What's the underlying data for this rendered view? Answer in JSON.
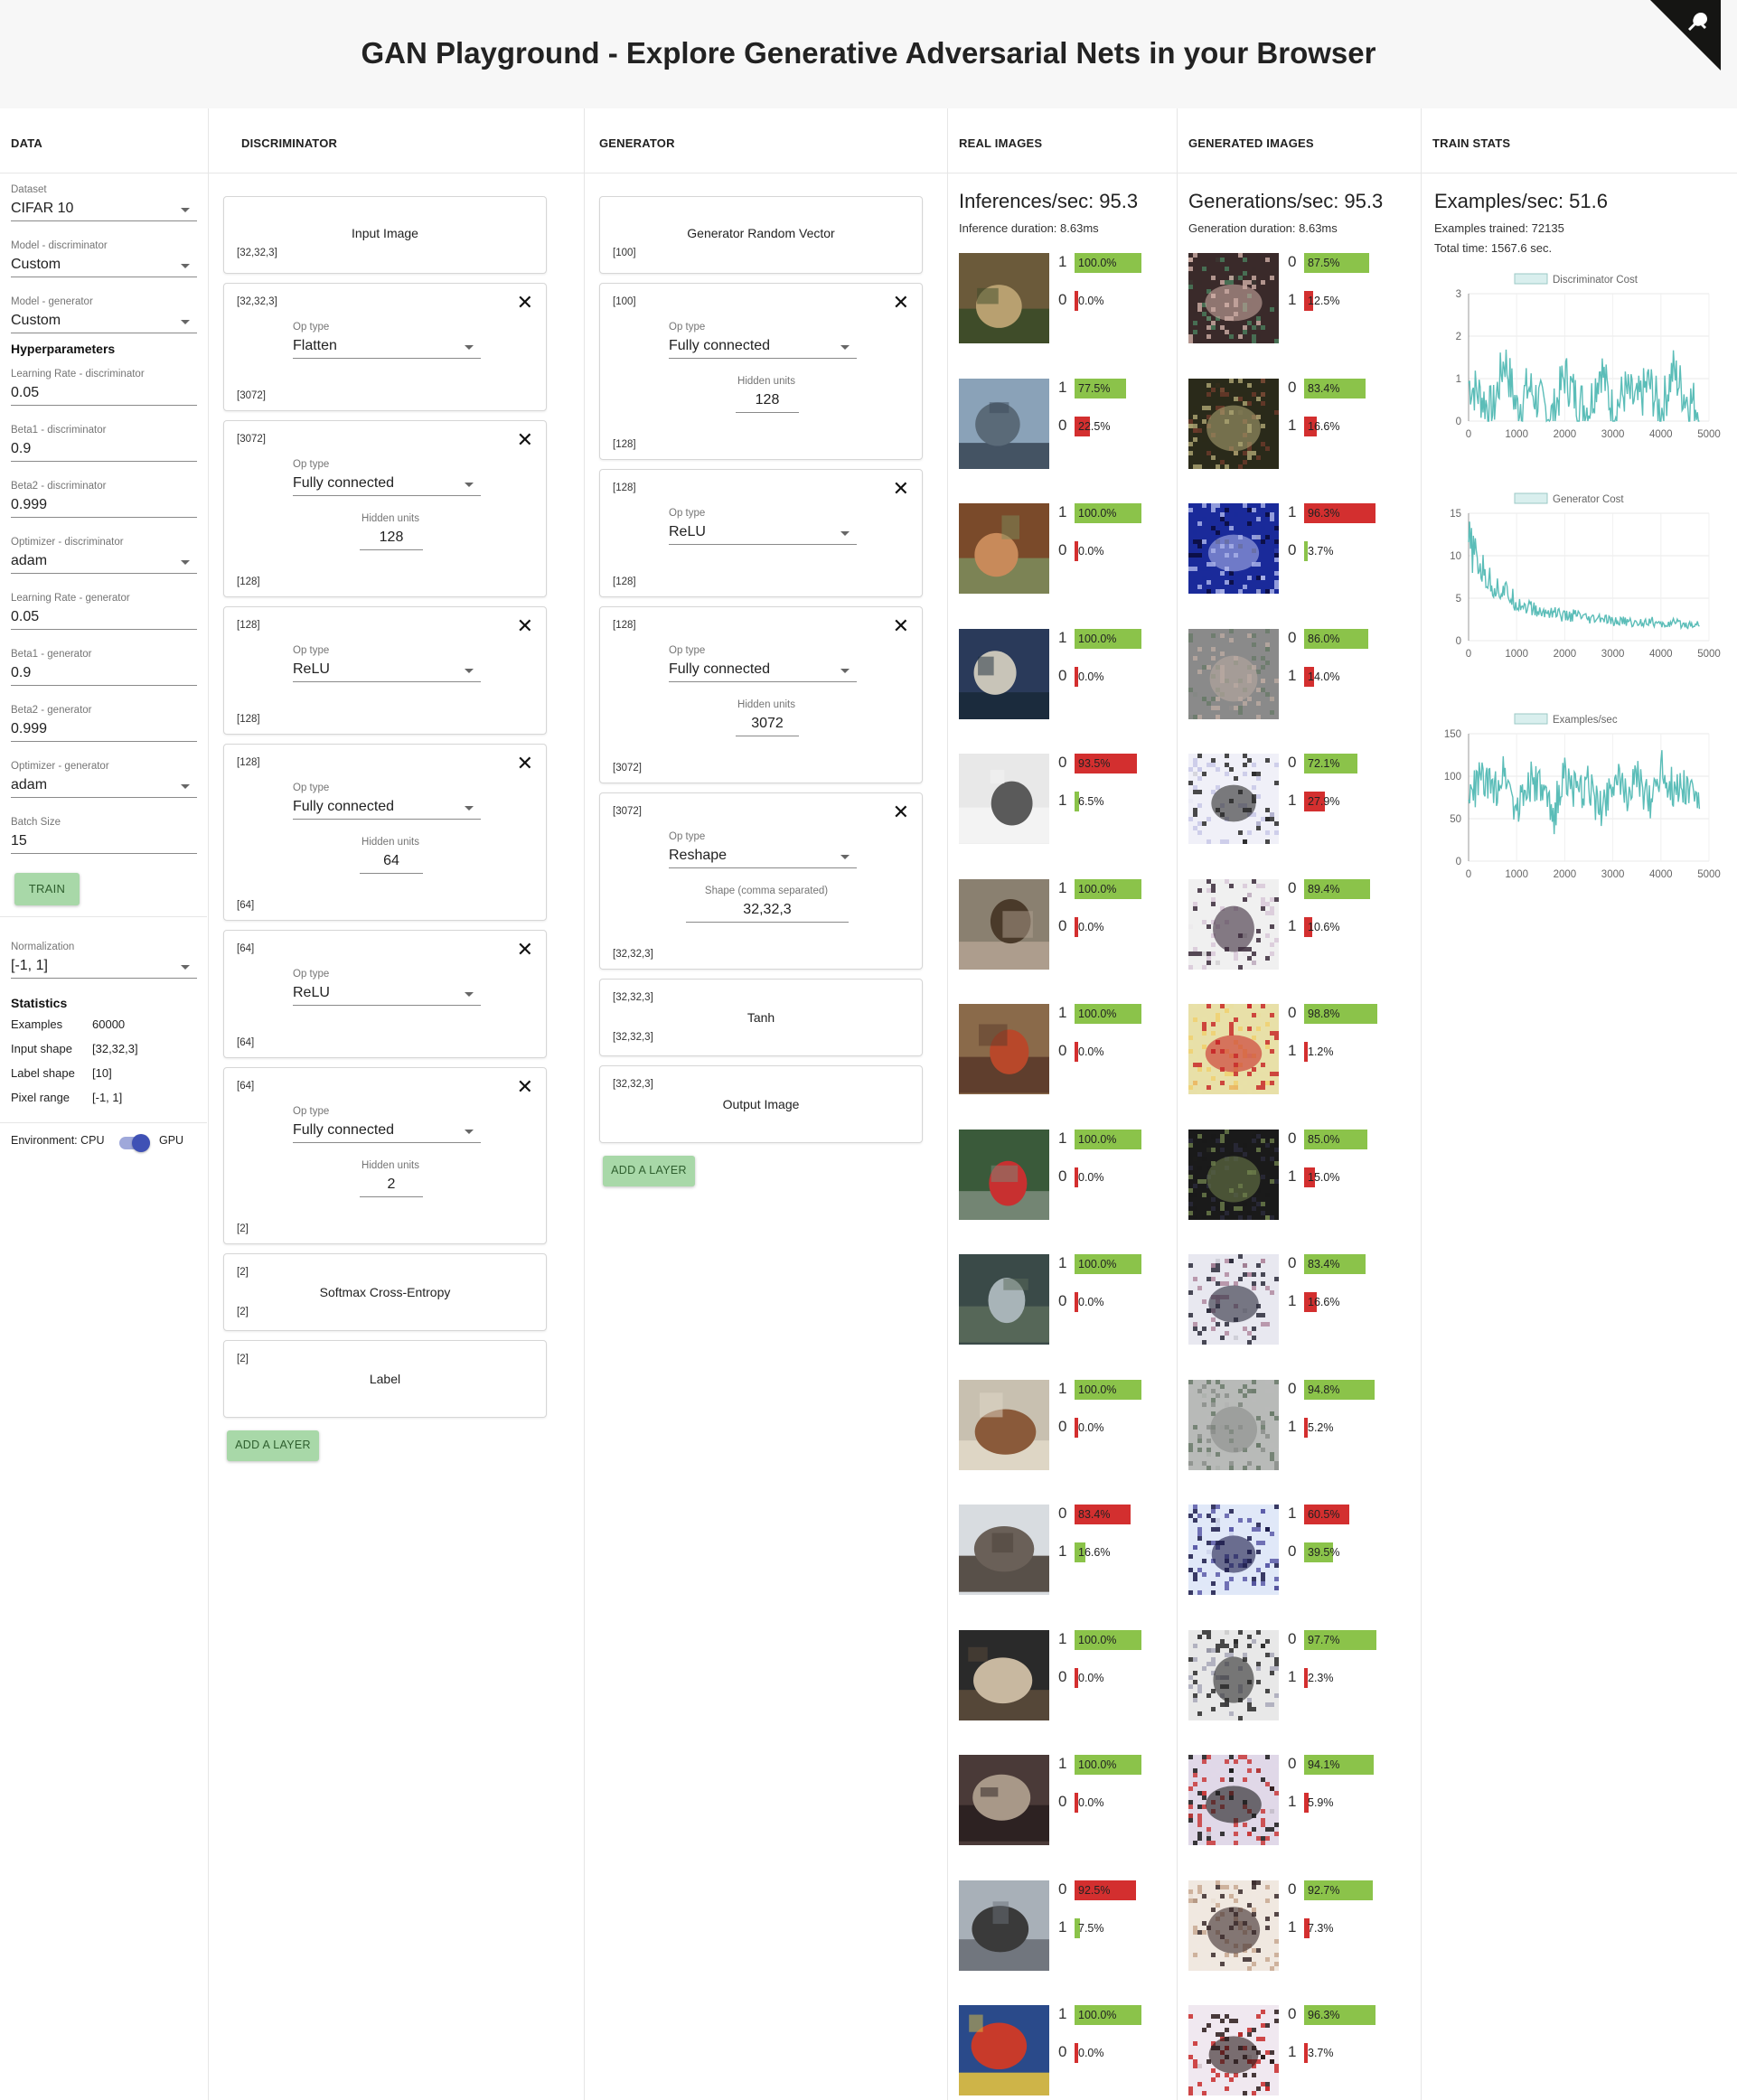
{
  "title": "GAN Playground - Explore Generative Adversarial Nets in your Browser",
  "columns": {
    "data": "DATA",
    "discriminator": "DISCRIMINATOR",
    "generator": "GENERATOR",
    "real": "REAL IMAGES",
    "generated": "GENERATED IMAGES",
    "stats": "TRAIN STATS"
  },
  "data_panel": {
    "dataset": {
      "label": "Dataset",
      "value": "CIFAR 10"
    },
    "model_disc": {
      "label": "Model - discriminator",
      "value": "Custom"
    },
    "model_gen": {
      "label": "Model - generator",
      "value": "Custom"
    },
    "hyper_title": "Hyperparameters",
    "lr_disc": {
      "label": "Learning Rate - discriminator",
      "value": "0.05"
    },
    "beta1_disc": {
      "label": "Beta1 - discriminator",
      "value": "0.9"
    },
    "beta2_disc": {
      "label": "Beta2 - discriminator",
      "value": "0.999"
    },
    "opt_disc": {
      "label": "Optimizer - discriminator",
      "value": "adam"
    },
    "lr_gen": {
      "label": "Learning Rate - generator",
      "value": "0.05"
    },
    "beta1_gen": {
      "label": "Beta1 - generator",
      "value": "0.9"
    },
    "beta2_gen": {
      "label": "Beta2 - generator",
      "value": "0.999"
    },
    "opt_gen": {
      "label": "Optimizer - generator",
      "value": "adam"
    },
    "batch": {
      "label": "Batch Size",
      "value": "15"
    },
    "train_button": "TRAIN",
    "normalization": {
      "label": "Normalization",
      "value": "[-1, 1]"
    },
    "stats_title": "Statistics",
    "stats": [
      {
        "k": "Examples",
        "v": "60000"
      },
      {
        "k": "Input shape",
        "v": "[32,32,3]"
      },
      {
        "k": "Label shape",
        "v": "[10]"
      },
      {
        "k": "Pixel range",
        "v": "[-1, 1]"
      }
    ],
    "env_label": "Environment: CPU",
    "env_gpu": "GPU"
  },
  "discriminator": {
    "input": {
      "shape": "[32,32,3]",
      "title": "Input Image"
    },
    "layers": [
      {
        "in": "[32,32,3]",
        "op_label": "Op type",
        "op": "Flatten",
        "hidden_label": "",
        "hidden": "",
        "out": "[3072]"
      },
      {
        "in": "[3072]",
        "op_label": "Op type",
        "op": "Fully connected",
        "hidden_label": "Hidden units",
        "hidden": "128",
        "out": "[128]"
      },
      {
        "in": "[128]",
        "op_label": "Op type",
        "op": "ReLU",
        "hidden_label": "",
        "hidden": "",
        "out": "[128]"
      },
      {
        "in": "[128]",
        "op_label": "Op type",
        "op": "Fully connected",
        "hidden_label": "Hidden units",
        "hidden": "64",
        "out": "[64]"
      },
      {
        "in": "[64]",
        "op_label": "Op type",
        "op": "ReLU",
        "hidden_label": "",
        "hidden": "",
        "out": "[64]"
      },
      {
        "in": "[64]",
        "op_label": "Op type",
        "op": "Fully connected",
        "hidden_label": "Hidden units",
        "hidden": "2",
        "out": "[2]"
      }
    ],
    "loss": {
      "in": "[2]",
      "title": "Softmax Cross-Entropy",
      "out": "[2]"
    },
    "label": {
      "in": "[2]",
      "title": "Label"
    },
    "add_button": "ADD A LAYER"
  },
  "generator": {
    "input": {
      "shape": "[100]",
      "title": "Generator Random Vector"
    },
    "layers": [
      {
        "in": "[100]",
        "op_label": "Op type",
        "op": "Fully connected",
        "hidden_label": "Hidden units",
        "hidden": "128",
        "out": "[128]"
      },
      {
        "in": "[128]",
        "op_label": "Op type",
        "op": "ReLU",
        "hidden_label": "",
        "hidden": "",
        "out": "[128]"
      },
      {
        "in": "[128]",
        "op_label": "Op type",
        "op": "Fully connected",
        "hidden_label": "Hidden units",
        "hidden": "3072",
        "out": "[3072]"
      },
      {
        "in": "[3072]",
        "op_label": "Op type",
        "op": "Reshape",
        "hidden_label": "Shape (comma separated)",
        "hidden": "32,32,3",
        "out": "[32,32,3]"
      }
    ],
    "tanh": {
      "in": "[32,32,3]",
      "title": "Tanh",
      "out": "[32,32,3]"
    },
    "output": {
      "in": "[32,32,3]",
      "title": "Output Image"
    },
    "add_button": "ADD A LAYER"
  },
  "real_images": {
    "stat": "Inferences/sec: 95.3",
    "sub": "Inference duration: 8.63ms",
    "items": [
      {
        "top": {
          "d": "1",
          "p": 100.0,
          "t": "100.0%"
        },
        "bot": {
          "d": "0",
          "p": 0.0,
          "t": "0.0%"
        },
        "colors": [
          "#6b5a3a",
          "#b8a070",
          "#3b4a28"
        ]
      },
      {
        "top": {
          "d": "1",
          "p": 77.5,
          "t": "77.5%"
        },
        "bot": {
          "d": "0",
          "p": 22.5,
          "t": "22.5%"
        },
        "colors": [
          "#8aa2b8",
          "#5a6a78",
          "#3c4a5a"
        ]
      },
      {
        "top": {
          "d": "1",
          "p": 100.0,
          "t": "100.0%"
        },
        "bot": {
          "d": "0",
          "p": 0.0,
          "t": "0.0%"
        },
        "colors": [
          "#7a4a2a",
          "#c88a5a",
          "#7c8a5a"
        ]
      },
      {
        "top": {
          "d": "1",
          "p": 100.0,
          "t": "100.0%"
        },
        "bot": {
          "d": "0",
          "p": 0.0,
          "t": "0.0%"
        },
        "colors": [
          "#2a3a5a",
          "#c8c4b8",
          "#1a2a3a"
        ]
      },
      {
        "top": {
          "d": "0",
          "p": 93.5,
          "t": "93.5%"
        },
        "bot": {
          "d": "1",
          "p": 6.5,
          "t": "6.5%"
        },
        "colors": [
          "#e8e8e8",
          "#5a5a5a",
          "#f4f4f4"
        ]
      },
      {
        "top": {
          "d": "1",
          "p": 100.0,
          "t": "100.0%"
        },
        "bot": {
          "d": "0",
          "p": 0.0,
          "t": "0.0%"
        },
        "colors": [
          "#8a8070",
          "#4a3a2a",
          "#b0a090"
        ]
      },
      {
        "top": {
          "d": "1",
          "p": 100.0,
          "t": "100.0%"
        },
        "bot": {
          "d": "0",
          "p": 0.0,
          "t": "0.0%"
        },
        "colors": [
          "#8a6a4a",
          "#b8482a",
          "#5a3a2a"
        ]
      },
      {
        "top": {
          "d": "1",
          "p": 100.0,
          "t": "100.0%"
        },
        "bot": {
          "d": "0",
          "p": 0.0,
          "t": "0.0%"
        },
        "colors": [
          "#3a5a3a",
          "#c83030",
          "#7a8a7a"
        ]
      },
      {
        "top": {
          "d": "1",
          "p": 100.0,
          "t": "100.0%"
        },
        "bot": {
          "d": "0",
          "p": 0.0,
          "t": "0.0%"
        },
        "colors": [
          "#3a4a48",
          "#a8b4b8",
          "#5a6a5a"
        ]
      },
      {
        "top": {
          "d": "1",
          "p": 100.0,
          "t": "100.0%"
        },
        "bot": {
          "d": "0",
          "p": 0.0,
          "t": "0.0%"
        },
        "colors": [
          "#c8c0b0",
          "#8a5a3a",
          "#e0d8c8"
        ]
      },
      {
        "top": {
          "d": "0",
          "p": 83.4,
          "t": "83.4%"
        },
        "bot": {
          "d": "1",
          "p": 16.6,
          "t": "16.6%"
        },
        "colors": [
          "#d8dce0",
          "#6a6058",
          "#4a4038"
        ]
      },
      {
        "top": {
          "d": "1",
          "p": 100.0,
          "t": "100.0%"
        },
        "bot": {
          "d": "0",
          "p": 0.0,
          "t": "0.0%"
        },
        "colors": [
          "#2a2a2a",
          "#c8b8a0",
          "#5a4a3a"
        ]
      },
      {
        "top": {
          "d": "1",
          "p": 100.0,
          "t": "100.0%"
        },
        "bot": {
          "d": "0",
          "p": 0.0,
          "t": "0.0%"
        },
        "colors": [
          "#4a3a38",
          "#a89888",
          "#2a2020"
        ]
      },
      {
        "top": {
          "d": "0",
          "p": 92.5,
          "t": "92.5%"
        },
        "bot": {
          "d": "1",
          "p": 7.5,
          "t": "7.5%"
        },
        "colors": [
          "#a8b0b8",
          "#3a3a3a",
          "#6a7078"
        ]
      },
      {
        "top": {
          "d": "1",
          "p": 100.0,
          "t": "100.0%"
        },
        "bot": {
          "d": "0",
          "p": 0.0,
          "t": "0.0%"
        },
        "colors": [
          "#2a4a8a",
          "#c83a2a",
          "#e0c040"
        ]
      }
    ]
  },
  "generated_images": {
    "stat": "Generations/sec: 95.3",
    "sub": "Generation duration: 8.63ms",
    "items": [
      {
        "top": {
          "d": "0",
          "p": 87.5,
          "t": "87.5%"
        },
        "bot": {
          "d": "1",
          "p": 12.5,
          "t": "12.5%"
        },
        "colors": [
          "#3a2a2a",
          "#c8a8a0",
          "#4a7a5a"
        ]
      },
      {
        "top": {
          "d": "0",
          "p": 83.4,
          "t": "83.4%"
        },
        "bot": {
          "d": "1",
          "p": 16.6,
          "t": "16.6%"
        },
        "colors": [
          "#2a2a1a",
          "#a8a070",
          "#6a3a2a"
        ]
      },
      {
        "top": {
          "d": "1",
          "p": 96.3,
          "t": "96.3%"
        },
        "bot": {
          "d": "0",
          "p": 3.7,
          "t": "3.7%"
        },
        "colors": [
          "#1a2a9a",
          "#a8b0e8",
          "#0a0a3a"
        ]
      },
      {
        "top": {
          "d": "0",
          "p": 86.0,
          "t": "86.0%"
        },
        "bot": {
          "d": "1",
          "p": 14.0,
          "t": "14.0%"
        },
        "colors": [
          "#8a8a8a",
          "#b8a8a0",
          "#6a7a6a"
        ]
      },
      {
        "top": {
          "d": "0",
          "p": 72.1,
          "t": "72.1%"
        },
        "bot": {
          "d": "1",
          "p": 27.9,
          "t": "27.9%"
        },
        "colors": [
          "#f0f0f8",
          "#2a2a2a",
          "#c8c8e8"
        ]
      },
      {
        "top": {
          "d": "0",
          "p": 89.4,
          "t": "89.4%"
        },
        "bot": {
          "d": "1",
          "p": 10.6,
          "t": "10.6%"
        },
        "colors": [
          "#f0f0f0",
          "#3a2a3a",
          "#d8c8d8"
        ]
      },
      {
        "top": {
          "d": "0",
          "p": 98.8,
          "t": "98.8%"
        },
        "bot": {
          "d": "1",
          "p": 1.2,
          "t": "1.2%"
        },
        "colors": [
          "#e8e0a8",
          "#c82a2a",
          "#f0d070"
        ]
      },
      {
        "top": {
          "d": "0",
          "p": 85.0,
          "t": "85.0%"
        },
        "bot": {
          "d": "1",
          "p": 15.0,
          "t": "15.0%"
        },
        "colors": [
          "#1a1a1a",
          "#6a7a4a",
          "#2a2a3a"
        ]
      },
      {
        "top": {
          "d": "0",
          "p": 83.4,
          "t": "83.4%"
        },
        "bot": {
          "d": "1",
          "p": 16.6,
          "t": "16.6%"
        },
        "colors": [
          "#e8e8f0",
          "#2a2a3a",
          "#b08aa0"
        ]
      },
      {
        "top": {
          "d": "0",
          "p": 94.8,
          "t": "94.8%"
        },
        "bot": {
          "d": "1",
          "p": 5.2,
          "t": "5.2%"
        },
        "colors": [
          "#b8bab8",
          "#8a8e8a",
          "#6a7a6a"
        ]
      },
      {
        "top": {
          "d": "1",
          "p": 60.5,
          "t": "60.5%"
        },
        "bot": {
          "d": "0",
          "p": 39.5,
          "t": "39.5%"
        },
        "colors": [
          "#e0e8f8",
          "#1a1a4a",
          "#5a5aa8"
        ]
      },
      {
        "top": {
          "d": "0",
          "p": 97.7,
          "t": "97.7%"
        },
        "bot": {
          "d": "1",
          "p": 2.3,
          "t": "2.3%"
        },
        "colors": [
          "#e8e8e8",
          "#2a2a2a",
          "#a8a8b8"
        ]
      },
      {
        "top": {
          "d": "0",
          "p": 94.1,
          "t": "94.1%"
        },
        "bot": {
          "d": "1",
          "p": 5.9,
          "t": "5.9%"
        },
        "colors": [
          "#e0d8e8",
          "#1a1a1a",
          "#c83a3a"
        ]
      },
      {
        "top": {
          "d": "0",
          "p": 92.7,
          "t": "92.7%"
        },
        "bot": {
          "d": "1",
          "p": 7.3,
          "t": "7.3%"
        },
        "colors": [
          "#f0e8e0",
          "#3a2a2a",
          "#c8a890"
        ]
      },
      {
        "top": {
          "d": "0",
          "p": 96.3,
          "t": "96.3%"
        },
        "bot": {
          "d": "1",
          "p": 3.7,
          "t": "3.7%"
        },
        "colors": [
          "#f0e8f0",
          "#2a1a1a",
          "#c82a2a"
        ]
      }
    ]
  },
  "train_stats": {
    "stat": "Examples/sec: 51.6",
    "trained": "Examples trained: 72135",
    "total": "Total time: 1567.6 sec.",
    "line_color": "#5bbdb8",
    "charts": [
      {
        "legend": "Discriminator Cost",
        "ymax": 3,
        "yticks": [
          "0",
          "1",
          "2",
          "3"
        ],
        "xticks": [
          "0",
          "1000",
          "2000",
          "3000",
          "4000",
          "5000"
        ]
      },
      {
        "legend": "Generator Cost",
        "ymax": 15,
        "yticks": [
          "0",
          "5",
          "10",
          "15"
        ],
        "xticks": [
          "0",
          "1000",
          "2000",
          "3000",
          "4000",
          "5000"
        ]
      },
      {
        "legend": "Examples/sec",
        "ymax": 150,
        "yticks": [
          "0",
          "50",
          "100",
          "150"
        ],
        "xticks": [
          "0",
          "1000",
          "2000",
          "3000",
          "4000",
          "5000"
        ]
      }
    ]
  },
  "chart_data": [
    {
      "type": "line",
      "title": "",
      "series": [
        {
          "name": "Discriminator Cost",
          "values": [
            0.9,
            0.6,
            0.2,
            1.5,
            0.3,
            0.8,
            0.4,
            0.1,
            1.1,
            0.5,
            0.3,
            1.3,
            0.2,
            0.7,
            0.4,
            0.9,
            0.2,
            1.2,
            0.6,
            0.3
          ]
        }
      ],
      "x": [
        0,
        250,
        500,
        750,
        1000,
        1250,
        1500,
        1750,
        2000,
        2250,
        2500,
        2750,
        3000,
        3250,
        3500,
        3750,
        4000,
        4250,
        4500,
        4800
      ],
      "ylim": [
        0,
        3
      ],
      "xlim": [
        0,
        5000
      ]
    },
    {
      "type": "line",
      "title": "",
      "series": [
        {
          "name": "Generator Cost",
          "values": [
            11.5,
            8.5,
            6.5,
            5.8,
            4.5,
            4.0,
            3.2,
            3.5,
            2.8,
            3.0,
            2.4,
            2.6,
            2.2,
            2.3,
            2.0,
            2.4,
            1.8,
            2.1,
            1.9,
            2.0
          ]
        }
      ],
      "x": [
        0,
        250,
        500,
        750,
        1000,
        1250,
        1500,
        1750,
        2000,
        2250,
        2500,
        2750,
        3000,
        3250,
        3500,
        3750,
        4000,
        4250,
        4500,
        4800
      ],
      "ylim": [
        0,
        15
      ],
      "xlim": [
        0,
        5000
      ]
    },
    {
      "type": "line",
      "title": "",
      "series": [
        {
          "name": "Examples/sec",
          "values": [
            70,
            100,
            80,
            110,
            60,
            95,
            85,
            50,
            105,
            75,
            90,
            60,
            100,
            80,
            95,
            70,
            110,
            85,
            90,
            75
          ]
        }
      ],
      "x": [
        0,
        250,
        500,
        750,
        1000,
        1250,
        1500,
        1750,
        2000,
        2250,
        2500,
        2750,
        3000,
        3250,
        3500,
        3750,
        4000,
        4250,
        4500,
        4800
      ],
      "ylim": [
        0,
        150
      ],
      "xlim": [
        0,
        5000
      ]
    }
  ]
}
